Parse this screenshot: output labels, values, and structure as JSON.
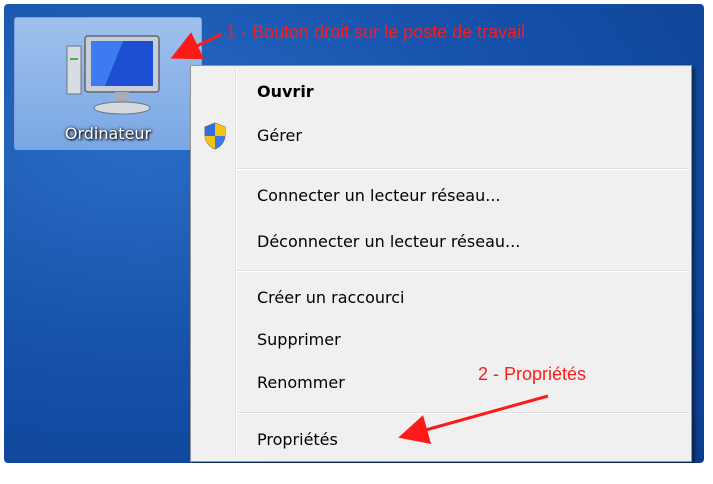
{
  "desktop": {
    "icon_label": "Ordinateur"
  },
  "menu": {
    "items": [
      {
        "label": "Ouvrir",
        "bold": true
      },
      {
        "label": "Gérer",
        "icon": "uac-shield-icon"
      },
      {
        "label": "Connecter un lecteur réseau..."
      },
      {
        "label": "Déconnecter un lecteur réseau..."
      },
      {
        "label": "Créer un raccourci"
      },
      {
        "label": "Supprimer"
      },
      {
        "label": "Renommer"
      },
      {
        "label": "Propriétés"
      }
    ]
  },
  "annotations": {
    "step1": "1 - Bouton droit sur le poste de travail",
    "step2": "2 - Propriétés"
  },
  "colors": {
    "desktop": "#1652ab",
    "annotation": "#ff1a1a",
    "menu_bg": "#f0f0f0"
  }
}
